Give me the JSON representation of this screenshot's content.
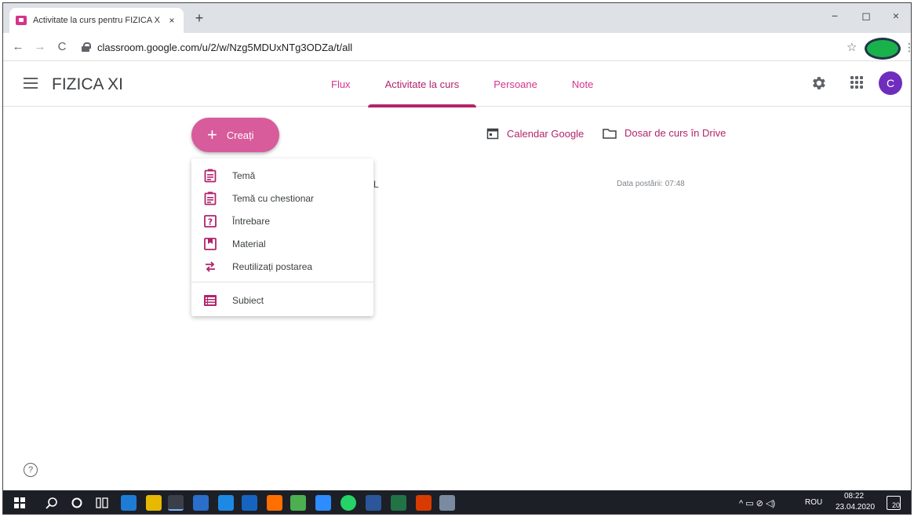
{
  "browser": {
    "tab_title": "Activitate la curs pentru FIZICA X",
    "tab_close": "×",
    "new_tab": "+",
    "url": "classroom.google.com/u/2/w/Nzg5MDUxNTg3ODZa/t/all",
    "back": "←",
    "forward": "→",
    "reload": "C",
    "star": "☆",
    "menu": "⋮",
    "minimize": "−",
    "maximize": "◻",
    "close": "×"
  },
  "classroom": {
    "title": "FIZICA XI",
    "tabs": [
      {
        "label": "Flux"
      },
      {
        "label": "Activitate la curs"
      },
      {
        "label": "Persoane"
      },
      {
        "label": "Note"
      }
    ],
    "active_tab": "Activitate la curs",
    "avatar_letter": "C",
    "accent": "#b1246c",
    "avatar_color": "#6f2dbd"
  },
  "content": {
    "create_label": "Creați",
    "calendar_link": "Calendar Google",
    "drive_link": "Dosar de curs în Drive",
    "posted_text": "Data postării: 07:48",
    "partial_letter": "L",
    "help": "?"
  },
  "create_menu": {
    "items": [
      {
        "label": "Temă",
        "icon": "assignment-icon"
      },
      {
        "label": "Temă cu chestionar",
        "icon": "quiz-assignment-icon"
      },
      {
        "label": "Întrebare",
        "icon": "question-icon"
      },
      {
        "label": "Material",
        "icon": "material-icon"
      },
      {
        "label": "Reutilizați postarea",
        "icon": "reuse-icon"
      }
    ],
    "topic": {
      "label": "Subiect",
      "icon": "topic-icon"
    }
  },
  "taskbar": {
    "language": "ROU",
    "time": "08:22",
    "date": "23.04.2020",
    "notification_count": "20"
  }
}
